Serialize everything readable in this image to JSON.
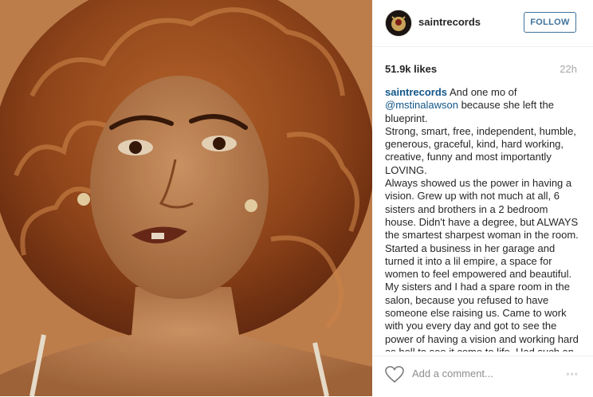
{
  "post": {
    "photo_description_icon": "portrait-photo",
    "username": "saintrecords",
    "follow_label": "FOLLOW",
    "likes": "51.9k likes",
    "time": "22h",
    "caption_user": "saintrecords",
    "caption_lines": [
      {
        "pre": "And one mo of",
        "mention": "",
        "post": ""
      },
      {
        "pre": "",
        "mention": "@mstinalawson",
        "post": " because she left the blueprint."
      },
      {
        "pre": "Strong, smart, free, independent, humble, generous, graceful, kind, hard working, creative, funny and most importantly LOVING.",
        "mention": "",
        "post": ""
      },
      {
        "pre": "Always showed us the power in having a vision. Grew up with not much at all, 6 sisters and brothers in a 2 bedroom house. Didn't have a degree, but ALWAYS the smartest sharpest woman in the room. Started a business in her garage and turned it into a lil empire, a space for women to feel empowered and beautiful. My sisters and I had a spare room in the salon, because you refused to have someone else raising us. Came to work with you every day and got to see the power of having a vision and working hard as hell to see it come to life. Had such an incredible tribe of women (Vernell, Cheryl,",
        "mention": "",
        "post": ""
      }
    ],
    "comment_placeholder": "Add a comment...",
    "more_label": "◦◦◦"
  },
  "colors": {
    "link": "#125688",
    "follow": "#3f729b",
    "muted": "#a5a7aa"
  }
}
